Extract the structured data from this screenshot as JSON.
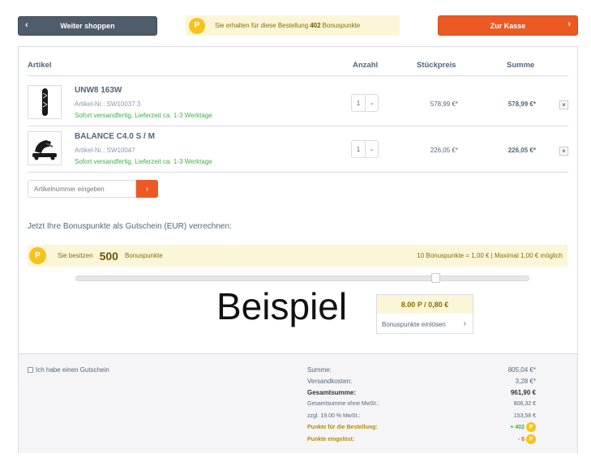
{
  "topbar": {
    "back_label": "Weiter shoppen",
    "bonus_text_pre": "Sie erhalten für diese Bestellung",
    "bonus_points": "402",
    "bonus_text_post": "Bonuspunkte",
    "checkout_label": "Zur Kasse",
    "coin_label": "P"
  },
  "cart": {
    "headers": {
      "article": "Artikel",
      "quantity": "Anzahl",
      "unit_price": "Stückpreis",
      "total": "Summe"
    },
    "items": [
      {
        "name": "UNW8 163W",
        "number": "Artikel-Nr.: SW10037.3",
        "delivery": "Sofort versandfertig, Lieferzeit ca. 1-3 Werktage",
        "qty": "1",
        "unit_price": "578,99 €*",
        "total": "578,99 €*"
      },
      {
        "name": "BALANCE C4.0 S / M",
        "number": "Artikel-Nr.: SW10047",
        "delivery": "Sofort versandfertig, Lieferzeit ca. 1-3 Werktage",
        "qty": "1",
        "unit_price": "226,05 €*",
        "total": "226,05 €*"
      }
    ],
    "article_input_placeholder": "Artikelnummer eingeben"
  },
  "bonus": {
    "title": "Jetzt Ihre Bonuspunkte als Gutschein (EUR) verrechnen:",
    "owned_pre": "Sie besitzen",
    "owned_points": "500",
    "owned_post": "Bonuspunkte",
    "rate": "10 Bonuspunkte = 1,00 € | Maximal 1,00 € möglich",
    "slider_value": "8.00 P / 0,80 €",
    "slider_level": 0.8,
    "redeem_label": "Bonuspunkte einlösen",
    "watermark": "Beispiel"
  },
  "summary": {
    "voucher_label": "Ich habe einen Gutschein",
    "rows": [
      {
        "label": "Summe:",
        "value": "805,04 €*"
      },
      {
        "label": "Versandkosten:",
        "value": "3,28 €*"
      },
      {
        "label": "Gesamtsumme:",
        "value": "961,90 €"
      },
      {
        "label": "Gesamtsumme ohne MwSt.:",
        "value": "808,32 €"
      },
      {
        "label": "zzgl. 19.00 % MwSt.:",
        "value": "153,58 €"
      },
      {
        "label": "Punkte für die Bestellung:",
        "value": "+ 402"
      },
      {
        "label": "Punkte eingelöst:",
        "value": "- 0"
      }
    ]
  },
  "colors": {
    "accent": "#ec5a24",
    "coin": "#f8c21a",
    "success": "#3cb148",
    "banner": "#fbf6d8"
  }
}
